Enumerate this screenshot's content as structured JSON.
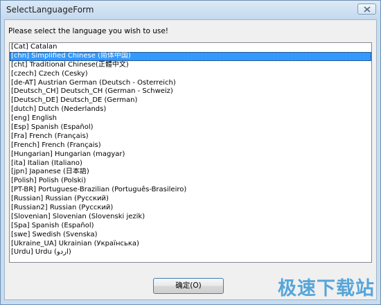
{
  "window": {
    "title": "SelectLanguageForm"
  },
  "prompt": "Please select the language you wish to use!",
  "languages": [
    "[Cat] Catalan",
    "[chn] Simplified Chinese (简体中国)",
    "[cht] Traditional Chinese(正體中文)",
    "[czech] Czech (Česky)",
    "[de-AT] Austrian German (Deutsch - Österreich)",
    "[Deutsch_CH] Deutsch_CH (German - Schweiz)",
    "[Deutsch_DE] Deutsch_DE (German)",
    "[dutch] Dutch (Nederlands)",
    "[eng] English",
    "[Esp] Spanish (Español)",
    "[Fra] French (Français)",
    "[French] French (Français)",
    "[Hungarian] Hungarian (magyar)",
    "[ita] Italian (Italiano)",
    "[jpn] Japanese (日本語)",
    "[Polish] Polish (Polski)",
    "[PT-BR] Portuguese-Brazilian (Português-Brasileiro)",
    "[Russian] Russian (Русский)",
    "[Russian2] Russian (Русский)",
    "[Slovenian] Slovenian (Slovenski jezik)",
    "[Spa] Spanish (Español)",
    "[swe] Swedish (Svenska)",
    "[Ukraine_UA] Ukrainian (Українська)",
    "[Urdu] Urdu (اردو)"
  ],
  "selected_index": 1,
  "ok_button": "确定(O)",
  "watermark": "极速下载站",
  "colors": {
    "selection": "#3399ff",
    "window_frame": "#c7dcef",
    "watermark": "#4a9fd8"
  }
}
